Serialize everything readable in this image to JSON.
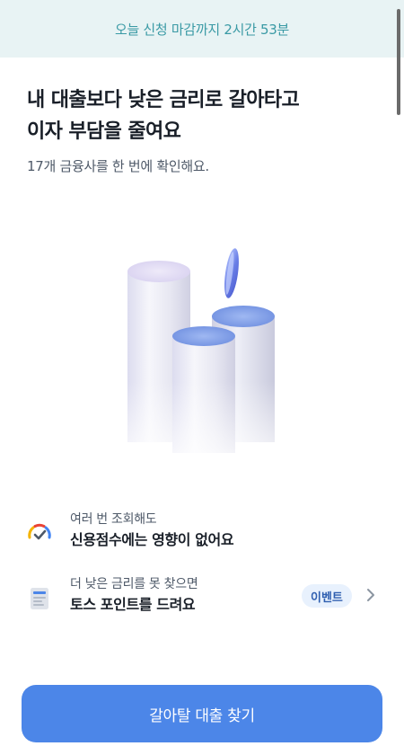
{
  "banner": {
    "text": "오늘 신청 마감까지 2시간 53분"
  },
  "headline": {
    "line1": "내 대출보다 낮은 금리로 갈아타고",
    "line2": "이자 부담을 줄여요"
  },
  "subtitle": "17개 금융사를 한 번에 확인해요.",
  "illustration": {
    "icon": "coin-cylinders-illustration"
  },
  "features": [
    {
      "icon": "credit-score-gauge-icon",
      "sub": "여러 번 조회해도",
      "main": "신용점수에는 영향이 없어요"
    },
    {
      "icon": "document-icon",
      "sub": "더 낮은 금리를 못 찾으면",
      "main": "토스 포인트를 드려요",
      "badge": "이벤트",
      "action_icon": "chevron-right-icon"
    }
  ],
  "cta": {
    "label": "갈아탈 대출 찾기"
  },
  "colors": {
    "banner_bg": "#e8f3f4",
    "banner_text": "#3a9aa5",
    "accent": "#4c86e8",
    "badge_bg": "#e8f1fd",
    "badge_text": "#2f5fb0"
  }
}
